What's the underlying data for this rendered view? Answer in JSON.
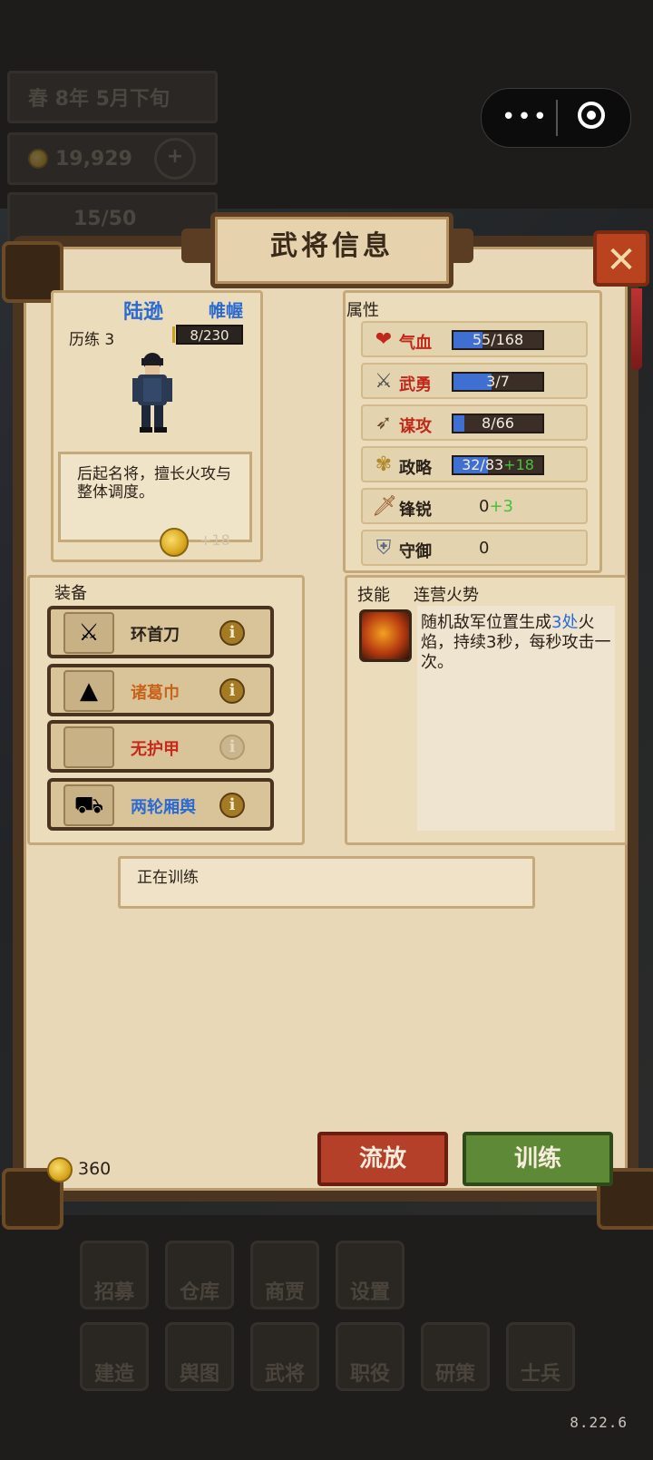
{
  "hud": {
    "date": "春  8年  5月下旬",
    "gold": "19,929",
    "population": "15/50",
    "plus_icon": "plus-icon"
  },
  "capsule": {
    "more_icon": "more-dots-icon",
    "close_icon": "target-icon"
  },
  "dialog": {
    "title": "武将信息",
    "close_label": "✕"
  },
  "hero": {
    "name": "陆逊",
    "tag": "帷幄",
    "level_label": "历练 3",
    "xp": "8/230",
    "description": "后起名将，擅长火攻与整体调度。",
    "desc_bonus": "+18"
  },
  "attributes": {
    "title": "属性",
    "items": [
      {
        "label": "气血",
        "value": "55/168",
        "fill": 0.33,
        "color": "#c0281a",
        "icon": "heart-icon"
      },
      {
        "label": "武勇",
        "value": "3/7",
        "fill": 0.43,
        "color": "#c0281a",
        "icon": "crossed-swords-icon"
      },
      {
        "label": "谋攻",
        "value": "8/66",
        "fill": 0.12,
        "color": "#c0281a",
        "icon": "bow-icon"
      },
      {
        "label": "政略",
        "value": "32/83",
        "bonus": "+18",
        "fill": 0.39,
        "color": "#2a2118",
        "icon": "wheat-icon"
      },
      {
        "label": "锋锐",
        "value": "0",
        "bonus": "+3",
        "color": "#2a2118",
        "icon": "sword-icon"
      },
      {
        "label": "守御",
        "value": "0",
        "color": "#2a2118",
        "icon": "shield-icon"
      }
    ]
  },
  "equipment": {
    "title": "装备",
    "items": [
      {
        "name": "环首刀",
        "color": "#2a2118",
        "icon": "sword-icon",
        "info": "i"
      },
      {
        "name": "诸葛巾",
        "color": "#c8641a",
        "icon": "hat-icon",
        "info": "i"
      },
      {
        "name": "无护甲",
        "color": "#c8281a",
        "icon": "empty-slot-icon",
        "info": "i"
      },
      {
        "name": "两轮厢舆",
        "color": "#2b6bd1",
        "icon": "cart-icon",
        "info": "i"
      }
    ]
  },
  "skill": {
    "title": "技能",
    "name": "连营火势",
    "text_before": "随机敌军位置生成",
    "text_highlight": "3处",
    "text_after": "火焰，持续3秒，每秒攻击一次。"
  },
  "status": "正在训练",
  "footer": {
    "money": "360",
    "exile_label": "流放",
    "train_label": "训练"
  },
  "bottom_menu": {
    "row1": [
      "招募",
      "仓库",
      "商贾",
      "设置"
    ],
    "row2": [
      "建造",
      "舆图",
      "武将",
      "职役",
      "研策",
      "士兵"
    ]
  },
  "version": "8.22.6"
}
